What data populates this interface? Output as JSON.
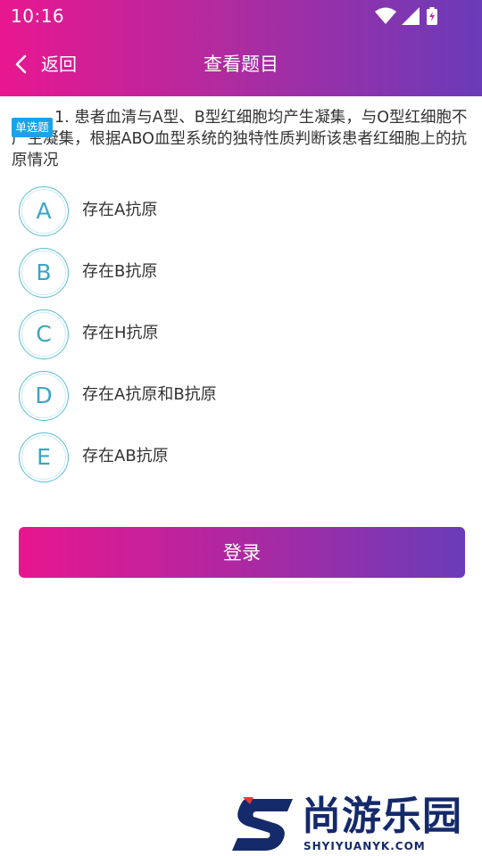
{
  "status_bar": {
    "time": "10:16"
  },
  "navbar": {
    "back_label": "返回",
    "title": "查看题目"
  },
  "question": {
    "badge": "单选题",
    "text": "1. 患者血清与A型、B型红细胞均产生凝集，与O型红细胞不产生凝集，根据ABO血型系统的独特性质判断该患者红细胞上的抗原情况"
  },
  "options": [
    {
      "letter": "A",
      "text": "存在A抗原"
    },
    {
      "letter": "B",
      "text": "存在B抗原"
    },
    {
      "letter": "C",
      "text": "存在H抗原"
    },
    {
      "letter": "D",
      "text": "存在A抗原和B抗原"
    },
    {
      "letter": "E",
      "text": "存在AB抗原"
    }
  ],
  "login_button": "登录",
  "watermark": {
    "name": "尚游乐园",
    "url": "SHYIYUANYK.COM"
  },
  "colors": {
    "gradient_start": "#e8178f",
    "gradient_end": "#6a3bb8",
    "option_circle": "#5bbcd4",
    "badge": "#1aa3e8"
  }
}
